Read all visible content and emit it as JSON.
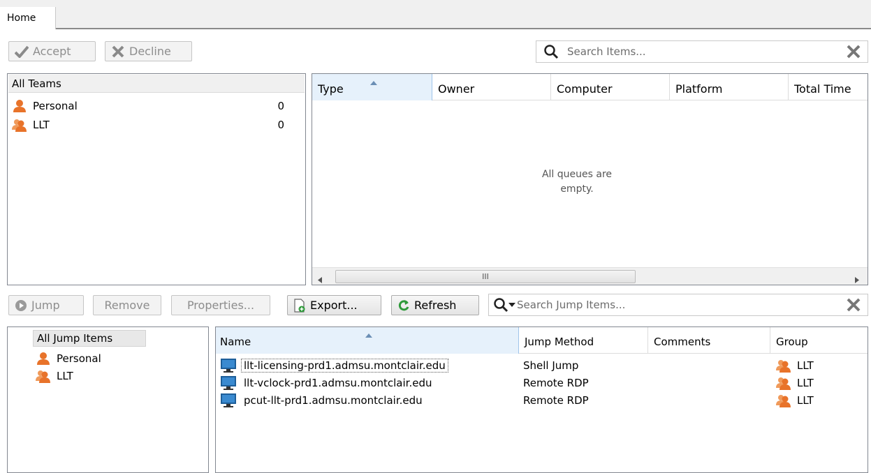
{
  "tabs": {
    "home": "Home"
  },
  "queue_toolbar": {
    "accept": "Accept",
    "decline": "Decline",
    "search_placeholder": "Search Items..."
  },
  "teams": {
    "header": "All Teams",
    "items": [
      {
        "label": "Personal",
        "count": "0"
      },
      {
        "label": "LLT",
        "count": "0"
      }
    ]
  },
  "queue_table": {
    "columns": [
      "Type",
      "Owner",
      "Computer",
      "Platform",
      "Total Time"
    ],
    "empty_message": "All queues are empty.",
    "scrollbar_grip": "III"
  },
  "jump_toolbar": {
    "jump": "Jump",
    "remove": "Remove",
    "properties": "Properties...",
    "export": "Export...",
    "refresh": "Refresh",
    "search_placeholder": "Search Jump Items..."
  },
  "jump_groups": {
    "header": "All Jump Items",
    "items": [
      {
        "label": "Personal"
      },
      {
        "label": "LLT"
      }
    ]
  },
  "jump_table": {
    "columns": [
      "Name",
      "Jump Method",
      "Comments",
      "Group"
    ],
    "rows": [
      {
        "name": "llt-licensing-prd1.admsu.montclair.edu",
        "method": "Shell Jump",
        "comments": "",
        "group": "LLT"
      },
      {
        "name": "llt-vclock-prd1.admsu.montclair.edu",
        "method": "Remote RDP",
        "comments": "",
        "group": "LLT"
      },
      {
        "name": "pcut-llt-prd1.admsu.montclair.edu",
        "method": "Remote RDP",
        "comments": "",
        "group": "LLT"
      }
    ]
  },
  "colors": {
    "accent_orange": "#e8732a",
    "header_selected": "#e6f1fb",
    "refresh_green": "#2e9a3a"
  }
}
